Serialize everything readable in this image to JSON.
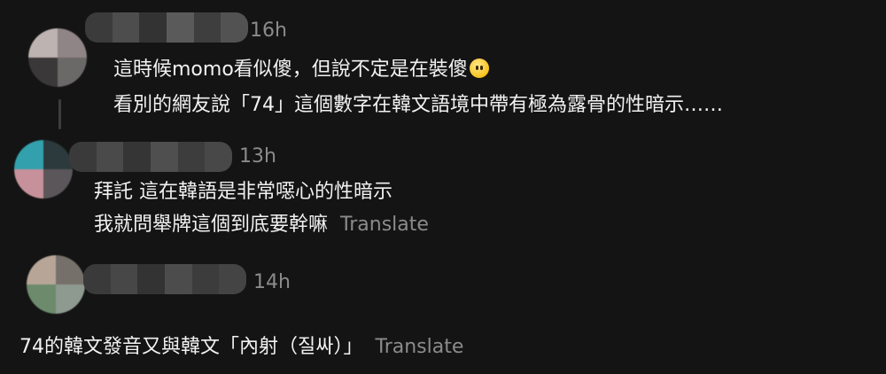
{
  "comments": [
    {
      "time": "16h",
      "lines": [
        "這時候momo看似傻，但說不定是在裝傻",
        "看別的網友說「74」這個數字在韓文語境中帶有極為露骨的性暗示……"
      ],
      "emoji": "face-without-mouth-emoji"
    },
    {
      "time": "13h",
      "lines": [
        "拜託 這在韓語是非常噁心的性暗示",
        "我就問舉牌這個到底要幹嘛"
      ],
      "translate_label": "Translate"
    },
    {
      "time": "14h",
      "lines": [
        "74的韓文發音又與韓文「內射（질싸）」"
      ],
      "translate_label": "Translate"
    }
  ],
  "colors": {
    "background": "#141414",
    "text": "#f2f2f2",
    "muted": "#8b8b8b"
  }
}
